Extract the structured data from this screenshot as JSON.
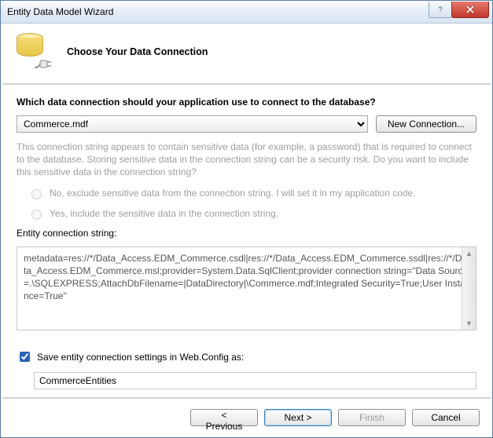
{
  "window": {
    "title": "Entity Data Model Wizard"
  },
  "header": {
    "heading": "Choose Your Data Connection"
  },
  "question": "Which data connection should your application use to connect to the database?",
  "connection": {
    "selected": "Commerce.mdf",
    "new_button": "New Connection..."
  },
  "explain": "This connection string appears to contain sensitive data (for example, a password) that is required to connect to the database. Storing sensitive data in the connection string can be a security risk. Do you want to include this sensitive data in the connection string?",
  "radios": {
    "exclude": "No, exclude sensitive data from the connection string. I will set it in my application code.",
    "include": "Yes, include the sensitive data in the connection string."
  },
  "conn_label": "Entity connection string:",
  "conn_string": "metadata=res://*/Data_Access.EDM_Commerce.csdl|res://*/Data_Access.EDM_Commerce.ssdl|res://*/Data_Access.EDM_Commerce.msl;provider=System.Data.SqlClient;provider connection string=\"Data Source=.\\SQLEXPRESS;AttachDbFilename=|DataDirectory|\\Commerce.mdf;Integrated Security=True;User Instance=True\"",
  "save": {
    "label": "Save entity connection settings in Web.Config as:",
    "value": "CommerceEntities",
    "checked": true
  },
  "footer": {
    "previous": "< Previous",
    "next": "Next >",
    "finish": "Finish",
    "cancel": "Cancel"
  }
}
